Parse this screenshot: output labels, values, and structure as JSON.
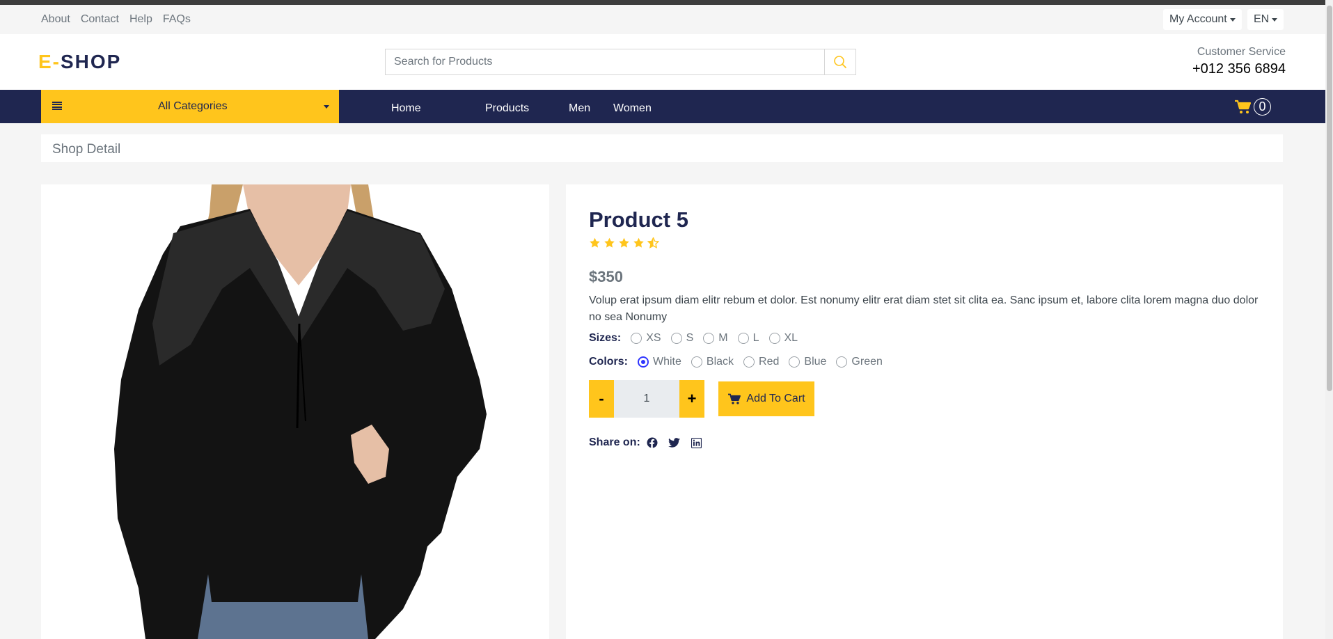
{
  "topbar": {
    "links": [
      "About",
      "Contact",
      "Help",
      "FAQs"
    ],
    "account": "My Account",
    "language": "EN"
  },
  "header": {
    "logo_prefix": "E-",
    "logo_main": "SHOP",
    "search_placeholder": "Search for Products",
    "service_label": "Customer Service",
    "service_phone": "+012 356 6894"
  },
  "nav": {
    "categories_label": "All Categories",
    "links": [
      "Home",
      "Products",
      "Men",
      "Women"
    ],
    "cart_count": "0"
  },
  "breadcrumb": "Shop Detail",
  "product": {
    "image_name": "black-lace-blouse-photo",
    "title": "Product 5",
    "rating": 4.5,
    "price": "$350",
    "description": "Volup erat ipsum diam elitr rebum et dolor. Est nonumy elitr erat diam stet sit clita ea. Sanc ipsum et, labore clita lorem magna duo dolor no sea Nonumy",
    "sizes_label": "Sizes:",
    "sizes": [
      "XS",
      "S",
      "M",
      "L",
      "XL"
    ],
    "colors_label": "Colors:",
    "colors": [
      "White",
      "Black",
      "Red",
      "Blue",
      "Green"
    ],
    "selected_color": "White",
    "quantity": "1",
    "minus": "-",
    "plus": "+",
    "add_to_cart": "Add To Cart",
    "share_label": "Share on:",
    "share_icons": [
      "facebook-icon",
      "twitter-icon",
      "linkedin-icon"
    ]
  },
  "colors": {
    "accent": "#ffc51c",
    "navy": "#1f2650",
    "radio": "#2f35ff"
  }
}
